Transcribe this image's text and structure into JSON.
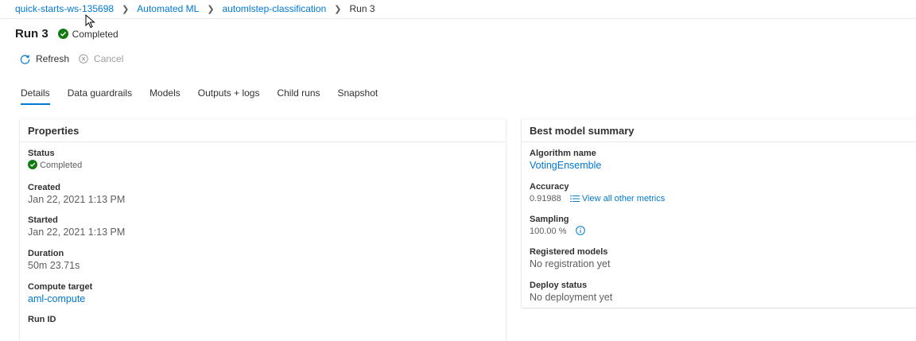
{
  "breadcrumb": {
    "workspace": "quick-starts-ws-135698",
    "section": "Automated ML",
    "experiment": "automlstep-classification",
    "current": "Run 3"
  },
  "header": {
    "title": "Run 3",
    "status": "Completed"
  },
  "commands": {
    "refresh": "Refresh",
    "cancel": "Cancel"
  },
  "tabs": [
    {
      "label": "Details",
      "active": true
    },
    {
      "label": "Data guardrails"
    },
    {
      "label": "Models"
    },
    {
      "label": "Outputs + logs"
    },
    {
      "label": "Child runs"
    },
    {
      "label": "Snapshot"
    }
  ],
  "properties": {
    "title": "Properties",
    "status_label": "Status",
    "status_value": "Completed",
    "created_label": "Created",
    "created_value": "Jan 22, 2021 1:13 PM",
    "started_label": "Started",
    "started_value": "Jan 22, 2021 1:13 PM",
    "duration_label": "Duration",
    "duration_value": "50m 23.71s",
    "compute_label": "Compute target",
    "compute_value": "aml-compute",
    "runid_label": "Run ID"
  },
  "best_model": {
    "title": "Best model summary",
    "algorithm_label": "Algorithm name",
    "algorithm_value": "VotingEnsemble",
    "accuracy_label": "Accuracy",
    "accuracy_value": "0.91988",
    "view_metrics": "View all other metrics",
    "sampling_label": "Sampling",
    "sampling_value": "100.00 %",
    "registered_label": "Registered models",
    "registered_value": "No registration yet",
    "deploy_label": "Deploy status",
    "deploy_value": "No deployment yet"
  },
  "colors": {
    "accent": "#0078d4",
    "success": "#107c10"
  },
  "icons": [
    "refresh-icon",
    "cancel-icon",
    "completed-check-icon",
    "list-icon",
    "info-icon",
    "chevron-right-icon",
    "mouse-cursor-icon"
  ]
}
